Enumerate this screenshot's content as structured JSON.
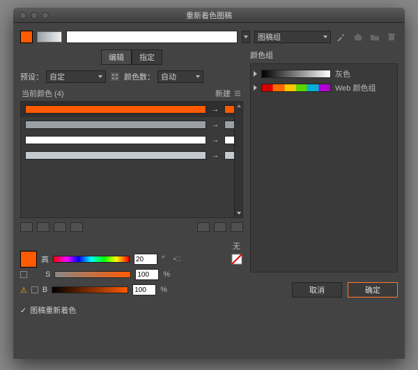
{
  "window": {
    "title": "重新着色图稿"
  },
  "topbar": {
    "artwork_group_label": "图稿组"
  },
  "tabs": {
    "edit": "编辑",
    "assign": "指定"
  },
  "preset": {
    "label": "预设：",
    "value": "自定",
    "count_label": "颜色数：",
    "count_value": "自动"
  },
  "colors": {
    "header": "当前颜色 (4)",
    "new_label": "新建"
  },
  "hsb": {
    "h_label": "高",
    "s_label": "S",
    "b_label": "B",
    "h_value": "20",
    "s_value": "100",
    "b_value": "100",
    "deg": "°",
    "pct": "%",
    "none_label": "无"
  },
  "right": {
    "title": "颜色组",
    "groups": [
      {
        "name": "灰色"
      },
      {
        "name": "Web 颜色组"
      }
    ]
  },
  "footer": {
    "recolor_label": "图稿重新着色",
    "cancel": "取消",
    "ok": "确定"
  }
}
